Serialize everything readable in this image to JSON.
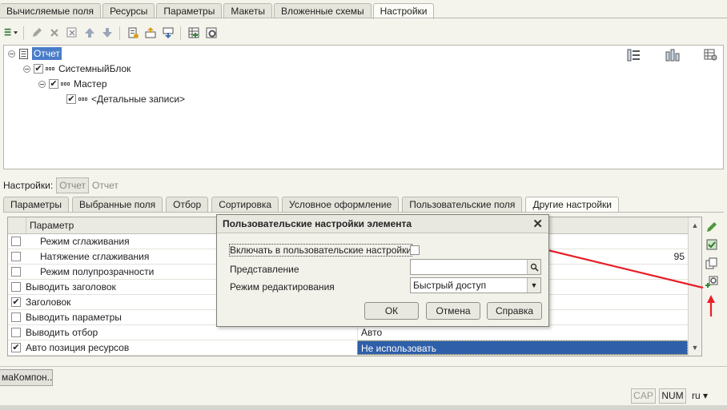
{
  "top_tabs": [
    "Вычисляемые поля",
    "Ресурсы",
    "Параметры",
    "Макеты",
    "Вложенные схемы",
    "Настройки"
  ],
  "top_active": "Настройки",
  "tree": {
    "root": "Отчет",
    "system_block": "СистемныйБлок",
    "master": "Мастер",
    "details": "<Детальные записи>"
  },
  "settings": {
    "label": "Настройки:",
    "value": "Отчет",
    "alt": "Отчет"
  },
  "lower_tabs": [
    "Параметры",
    "Выбранные поля",
    "Отбор",
    "Сортировка",
    "Условное оформление",
    "Пользовательские поля",
    "Другие настройки"
  ],
  "lower_active": "Другие настройки",
  "grid": {
    "header": "Параметр",
    "rows": [
      {
        "name": "Режим сглаживания",
        "checked": false,
        "value": ""
      },
      {
        "name": "Натяжение сглаживания",
        "checked": false,
        "value": "95"
      },
      {
        "name": "Режим полупрозрачности",
        "checked": false,
        "value": ""
      },
      {
        "name": "Выводить заголовок",
        "checked": false,
        "value": ""
      },
      {
        "name": "Заголовок",
        "checked": true,
        "value": ""
      },
      {
        "name": "Выводить параметры",
        "checked": false,
        "value": ""
      },
      {
        "name": "Выводить отбор",
        "checked": false,
        "value": "Авто"
      },
      {
        "name": "Авто позиция ресурсов",
        "checked": true,
        "value": "Не использовать"
      }
    ]
  },
  "dialog": {
    "title": "Пользовательские настройки элемента",
    "include_label": "Включать в пользовательские настройки",
    "representation_label": "Представление",
    "representation_value": "",
    "edit_mode_label": "Режим редактирования",
    "edit_mode_value": "Быстрый доступ",
    "ok": "ОК",
    "cancel": "Отмена",
    "help": "Справка"
  },
  "taskbar_item": "маКомпон...",
  "status": {
    "cap": "CAP",
    "num": "NUM",
    "lang": "ru"
  },
  "colors": {
    "selection": "#2f5fa9",
    "annotation": "#e8202a"
  }
}
